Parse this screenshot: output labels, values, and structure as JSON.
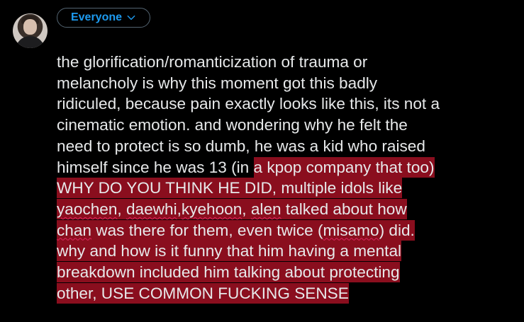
{
  "composer": {
    "audience_label": "Everyone",
    "accent_color": "#1d9bf0",
    "highlight_color": "#8a0e1e",
    "avatar_icon": "user-avatar",
    "chevron_icon": "chevron-down-icon"
  },
  "tweet": {
    "lines": [
      {
        "plain": "the glorification/romanticization of trauma or"
      },
      {
        "plain": "melancholy is why this moment got this badly"
      },
      {
        "plain": "ridiculed, because pain exactly looks like this, its not a"
      },
      {
        "plain": "cinematic emotion. and wondering why he felt the"
      },
      {
        "plain": "need to protect is so dumb, he was a kid who raised"
      },
      {
        "plain": "himself since he was 13 (in ",
        "selected": "a kpop company that too)"
      },
      {
        "selected": "WHY DO YOU THINK HE DID, multiple idols like"
      },
      {
        "sel_a": "yaochen",
        "sel_b": ", ",
        "sel_c": "daewhi",
        "sel_d": ",",
        "sel_e": "kyehoon",
        "sel_f": ", ",
        "sel_g": "alen",
        "sel_h": " talked about how"
      },
      {
        "sel_a": "chan",
        "sel_b": " was there for them, even twice (",
        "sel_c": "misamo",
        "sel_d": ") did."
      },
      {
        "selected": "why and how is it funny that him having a mental"
      },
      {
        "selected": "breakdown included him talking about protecting"
      },
      {
        "selected": "other, USE COMMON FUCKING SENSE "
      }
    ]
  }
}
